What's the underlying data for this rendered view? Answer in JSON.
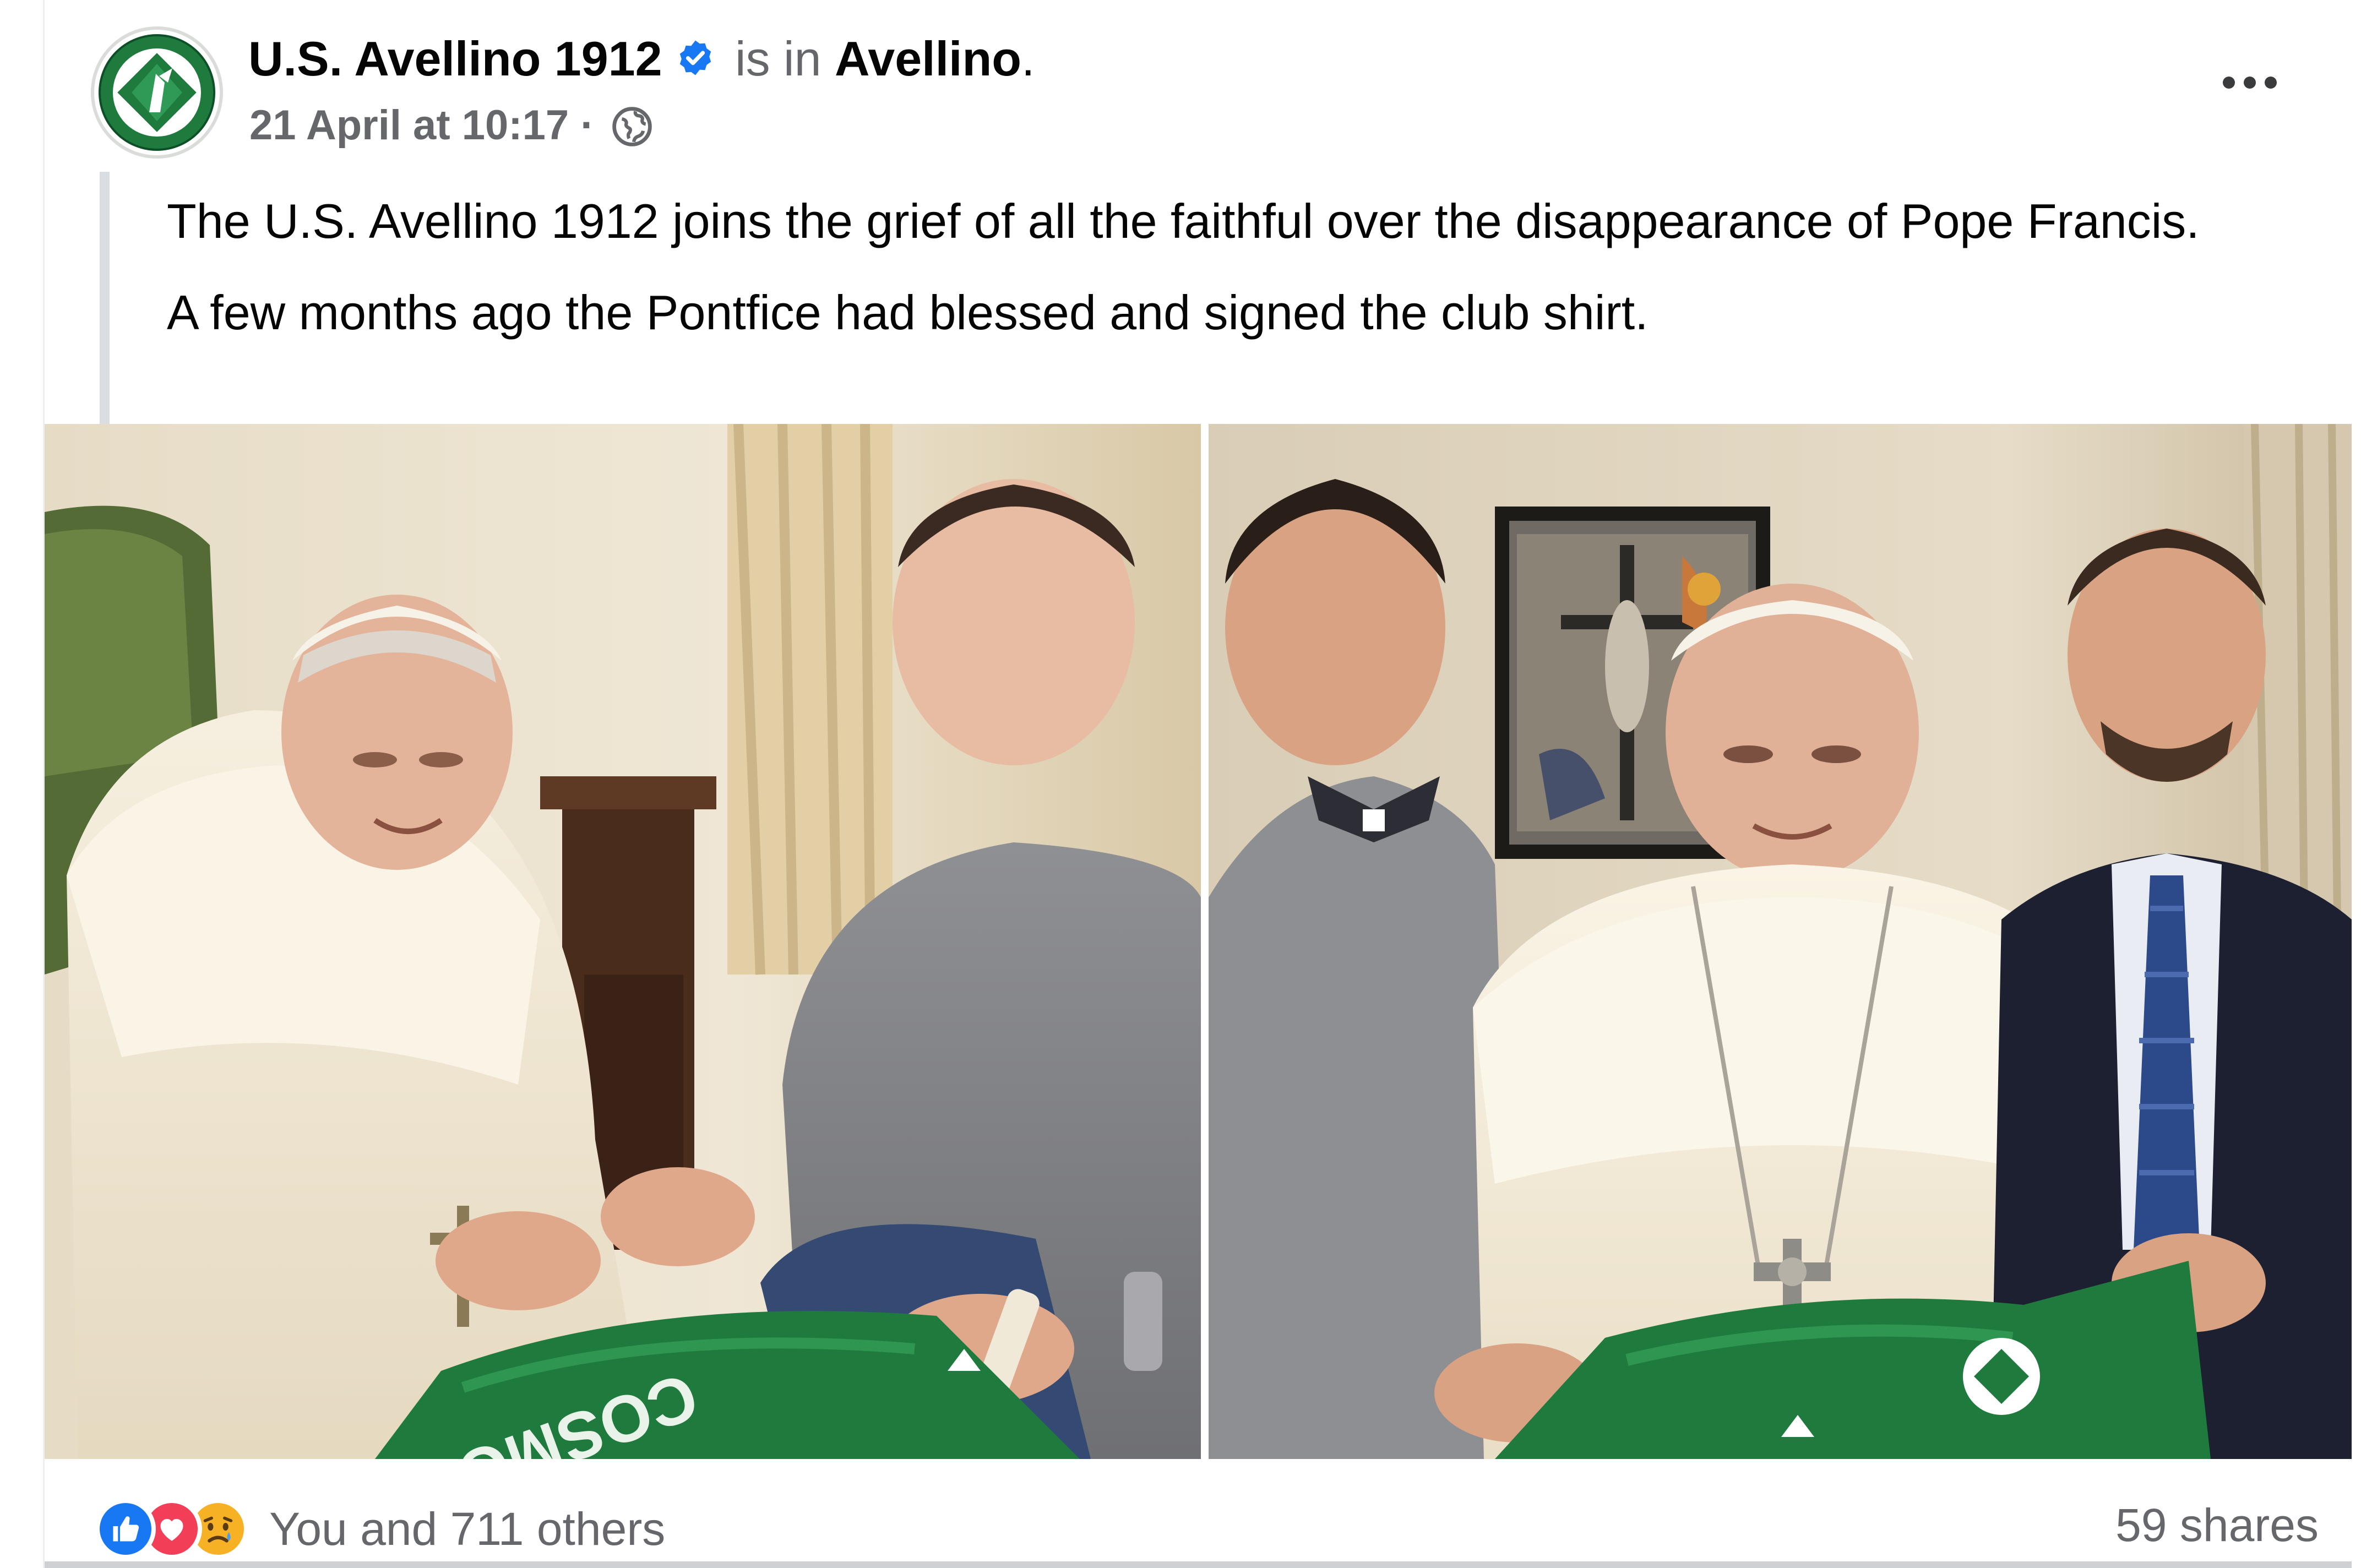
{
  "post": {
    "page_name": "U.S. Avellino 1912",
    "connector": "is in",
    "location": "Avellino",
    "location_suffix": ".",
    "timestamp": "21 April at 10:17",
    "separator": "·",
    "privacy_icon": "globe-icon",
    "verified_icon": "verified-badge-icon",
    "more_icon": "more-options-icon",
    "text_paragraphs": [
      "The U.S. Avellino 1912 joins the grief of all the faithful over the disappearance of Pope Francis.",
      "A few months ago the Pontfice had blessed and signed the club shirt."
    ]
  },
  "photos": [
    {
      "semantic": "photo-pope-signing-shirt",
      "shirt_print": "COSMOP"
    },
    {
      "semantic": "photo-pope-with-two-men-holding-shirt"
    }
  ],
  "footer": {
    "reaction_icons": [
      "like-icon",
      "love-icon",
      "sad-icon"
    ],
    "reactions_text": "You and 711 others",
    "shares_text": "59 shares"
  },
  "colors": {
    "text_primary": "#050505",
    "text_secondary": "#65676b",
    "verified_blue": "#1877f2",
    "like_blue": "#1877f2",
    "love_red": "#f33e58",
    "sad_yellow": "#f7b125",
    "club_green": "#1f7a3e"
  }
}
